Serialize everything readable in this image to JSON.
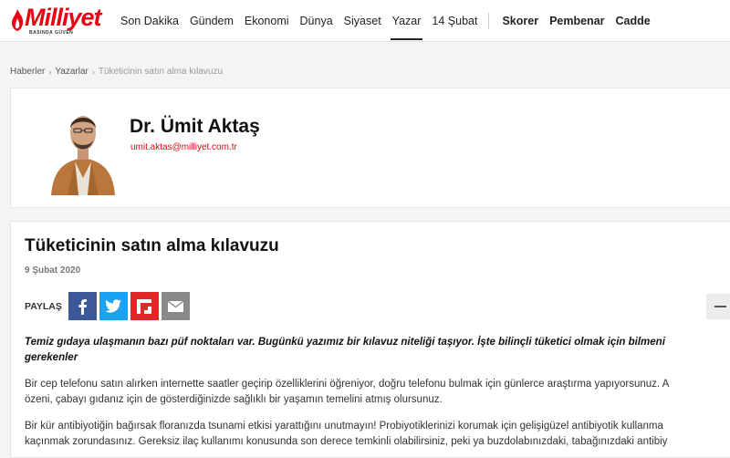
{
  "brand": {
    "name": "Milliyet",
    "tagline": "BASINDA GÜVEN",
    "accent": "#e30613"
  },
  "nav": {
    "items": [
      {
        "label": "Son Dakika",
        "active": false
      },
      {
        "label": "Gündem",
        "active": false
      },
      {
        "label": "Ekonomi",
        "active": false
      },
      {
        "label": "Dünya",
        "active": false
      },
      {
        "label": "Siyaset",
        "active": false
      },
      {
        "label": "Yazar",
        "active": true
      },
      {
        "label": "14 Şubat",
        "active": false
      }
    ],
    "extra": [
      {
        "label": "Skorer"
      },
      {
        "label": "Pembenar"
      },
      {
        "label": "Cadde"
      }
    ]
  },
  "breadcrumb": {
    "home": "Haberler",
    "section": "Yazarlar",
    "current": "Tüketicinin satın alma kılavuzu"
  },
  "author": {
    "name": "Dr. Ümit Aktaş",
    "email": "umit.aktas@milliyet.com.tr"
  },
  "article": {
    "title": "Tüketicinin satın alma kılavuzu",
    "date": "9 Şubat 2020",
    "share_label": "PAYLAŞ",
    "share_icons": [
      "facebook-icon",
      "twitter-icon",
      "flipboard-icon",
      "mail-icon"
    ],
    "lead_line1": "Temiz gıdaya ulaşmanın bazı püf noktaları var. Bugünkü yazımız bir kılavuz niteliği taşıyor. İşte bilinçli tüketici olmak için bilmeni",
    "lead_line2": "gerekenler",
    "p1_line1": "Bir cep telefonu satın alırken internette saatler geçirip özelliklerini öğreniyor, doğru telefonu bulmak için günlerce araştırma yapıyorsunuz. A",
    "p1_line2": "özeni, çabayı gıdanız için de gösterdiğinizde sağlıklı bir yaşamın temelini atmış olursunuz.",
    "p2_line1": "Bir kür antibiyotiğin bağırsak floranızda tsunami etkisi yarattığını unutmayın! Probiyotiklerinizi korumak için gelişigüzel antibiyotik kullanma",
    "p2_line2": "kaçınmak zorundasınız. Gereksiz ilaç kullanımı konusunda son derece temkinli olabilirsiniz, peki ya buzdolabınızdaki, tabağınızdaki antibiy"
  }
}
